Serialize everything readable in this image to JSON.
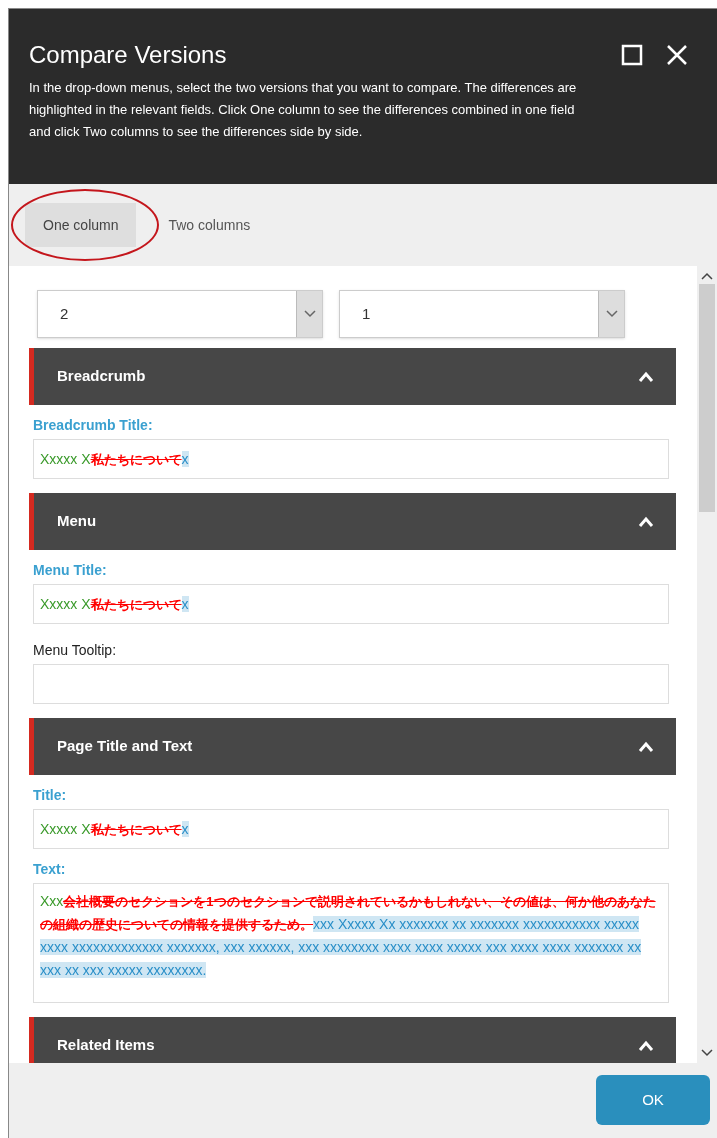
{
  "dialog": {
    "title": "Compare Versions",
    "description": "In the drop-down menus, select the two versions that you want to compare. The differences are highlighted in the relevant fields. Click One column to see the differences combined in one field and click Two columns to see the differences side by side."
  },
  "tabs": [
    {
      "label": "One column",
      "selected": true,
      "circled": true
    },
    {
      "label": "Two columns",
      "selected": false,
      "circled": false
    }
  ],
  "versions": [
    "2",
    "1"
  ],
  "sections": [
    {
      "title": "Breadcrumb",
      "expanded": true,
      "fields": [
        {
          "kind": "line",
          "label": "Breadcrumb Title:",
          "changed": true,
          "segments": [
            {
              "kind": "same",
              "text": "Xxxxx X"
            },
            {
              "kind": "deleted",
              "text": "私たちについて"
            },
            {
              "kind": "added",
              "text": "x"
            }
          ]
        }
      ]
    },
    {
      "title": "Menu",
      "expanded": true,
      "fields": [
        {
          "kind": "line",
          "label": "Menu Title:",
          "changed": true,
          "segments": [
            {
              "kind": "same",
              "text": "Xxxxx X"
            },
            {
              "kind": "deleted",
              "text": "私たちについて"
            },
            {
              "kind": "added",
              "text": "x"
            }
          ]
        },
        {
          "kind": "line",
          "label": "Menu Tooltip:",
          "changed": false
        }
      ]
    },
    {
      "title": "Page Title and Text",
      "expanded": true,
      "fields": [
        {
          "kind": "line",
          "label": "Title:",
          "changed": true,
          "segments": [
            {
              "kind": "same",
              "text": "Xxxxx X"
            },
            {
              "kind": "deleted",
              "text": "私たちについて"
            },
            {
              "kind": "added",
              "text": "x"
            }
          ]
        },
        {
          "kind": "area",
          "label": "Text:",
          "changed": true,
          "segments": [
            {
              "kind": "same",
              "text": "Xxx"
            },
            {
              "kind": "deleted",
              "text": "会社概要のセクションを1つのセクションで説明されているかもしれない、その値は、何か他のあなたの組織の歴史についての情報を提供するため。"
            },
            {
              "kind": "added",
              "text": "xxx Xxxxx Xx xxxxxxx xx xxxxxxx xxxxxxxxxxx xxxxx xxxx xxxxxxxxxxxxx xxxxxxx, xxx xxxxxx, xxx xxxxxxxx xxxx xxxx xxxxx xxx xxxx xxxx xxxxxxx xx xxx xx xxx xxxxx xxxxxxxx."
            }
          ]
        }
      ]
    },
    {
      "title": "Related Items",
      "expanded": true
    }
  ],
  "ok_button": "OK"
}
